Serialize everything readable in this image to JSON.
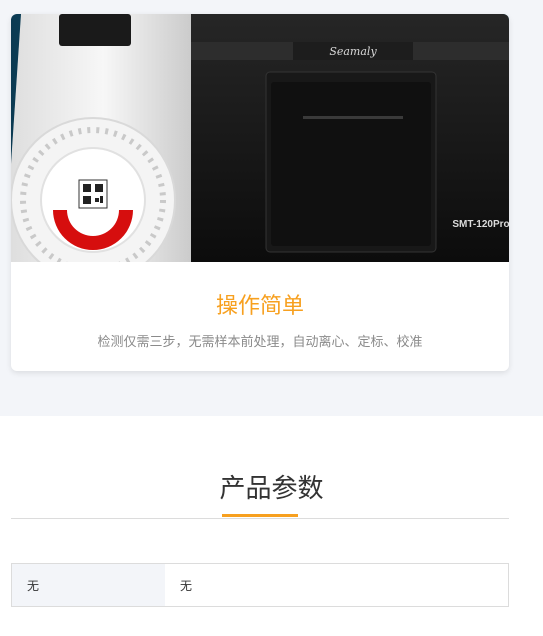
{
  "feature_card": {
    "brand": "Seamaly",
    "model": "SMT-120Pro",
    "title": "操作简单",
    "description": "检测仅需三步，无需样本前处理，自动离心、定标、校准"
  },
  "params_section": {
    "title": "产品参数",
    "rows": [
      {
        "name": "无",
        "value": "无"
      }
    ]
  },
  "colors": {
    "accent": "#f7a01f",
    "page_background": "#f3f5f9"
  }
}
